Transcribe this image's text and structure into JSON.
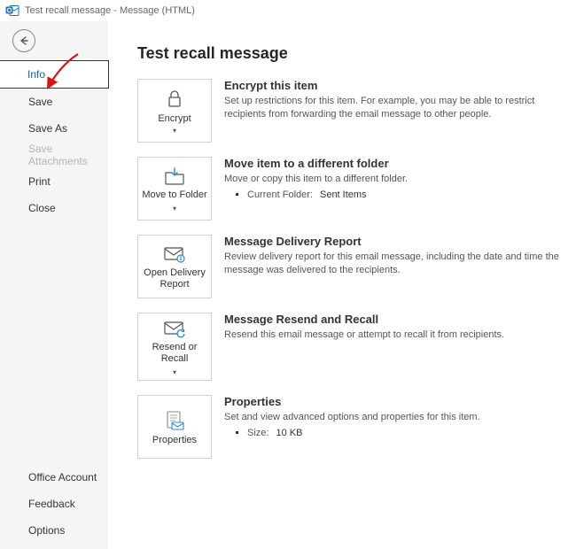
{
  "window": {
    "title": "Test recall message  -  Message (HTML)"
  },
  "sidebar": {
    "items": [
      {
        "label": "Info",
        "selected": true
      },
      {
        "label": "Save"
      },
      {
        "label": "Save As"
      },
      {
        "label": "Save Attachments",
        "disabled": true
      },
      {
        "label": "Print"
      },
      {
        "label": "Close"
      }
    ],
    "bottom": [
      {
        "label": "Office Account"
      },
      {
        "label": "Feedback"
      },
      {
        "label": "Options"
      }
    ]
  },
  "page": {
    "heading": "Test recall message",
    "sections": [
      {
        "tile_label": "Encrypt",
        "tile_dropdown": true,
        "title": "Encrypt this item",
        "body": "Set up restrictions for this item. For example, you may be able to restrict recipients from forwarding the email message to other people."
      },
      {
        "tile_label": "Move to Folder",
        "tile_dropdown": true,
        "title": "Move item to a different folder",
        "body": "Move or copy this item to a different folder.",
        "detail_key": "Current Folder:",
        "detail_val": "Sent Items"
      },
      {
        "tile_label": "Open Delivery Report",
        "tile_dropdown": false,
        "title": "Message Delivery Report",
        "body": "Review delivery report for this email message, including the date and time the message was delivered to the recipients."
      },
      {
        "tile_label": "Resend or Recall",
        "tile_dropdown": true,
        "title": "Message Resend and Recall",
        "body": "Resend this email message or attempt to recall it from recipients."
      },
      {
        "tile_label": "Properties",
        "tile_dropdown": false,
        "title": "Properties",
        "body": "Set and view advanced options and properties for this item.",
        "detail_key": "Size:",
        "detail_val": "10 KB"
      }
    ]
  }
}
